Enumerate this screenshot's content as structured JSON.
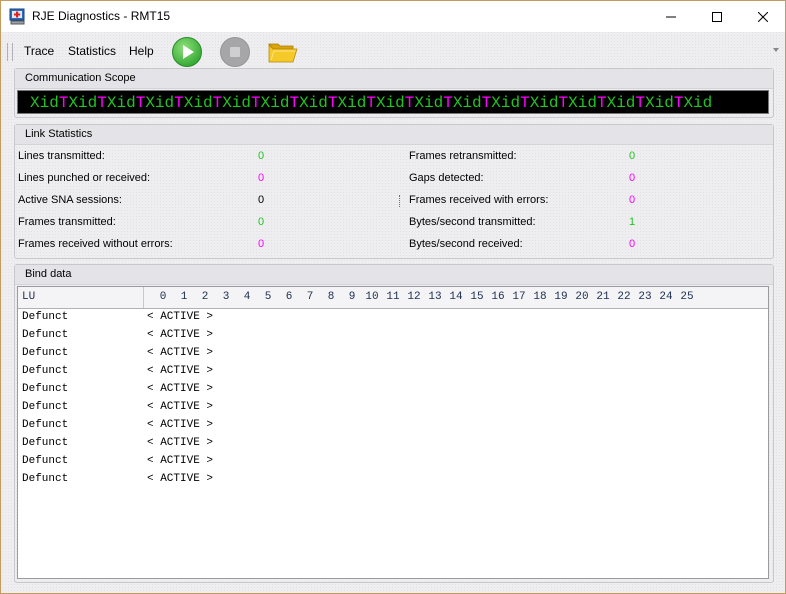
{
  "window": {
    "title": "RJE Diagnostics - RMT15",
    "controls": [
      "minimize",
      "maximize",
      "close"
    ]
  },
  "menu": {
    "items": [
      "Trace",
      "Statistics",
      "Help"
    ]
  },
  "toolbar": {
    "buttons": [
      {
        "name": "start",
        "icon": "play-icon",
        "enabled": true,
        "color": "#3cb83c"
      },
      {
        "name": "stop",
        "icon": "stop-icon",
        "enabled": false,
        "color": "#a8a8a8"
      },
      {
        "name": "open",
        "icon": "folder-icon",
        "enabled": true,
        "color": "#f2c21c"
      }
    ]
  },
  "communication_scope": {
    "title": "Communication Scope",
    "text": "XidTXidTXidTXidTXidTXidTXidTXidTXidTXidTXidTXidTXidTXidTXidTXidTXidTXid",
    "colors": {
      "data": "#22c322",
      "marker": "#ff00ff",
      "background": "#000000"
    }
  },
  "link_statistics": {
    "title": "Link Statistics",
    "left": [
      {
        "label": "Lines transmitted:",
        "value": "0",
        "color": "#22c322"
      },
      {
        "label": "Lines punched or received:",
        "value": "0",
        "color": "#ff00ff"
      },
      {
        "label": "Active SNA sessions:",
        "value": "0",
        "color": "#000000"
      },
      {
        "label": "Frames transmitted:",
        "value": "0",
        "color": "#22c322"
      },
      {
        "label": "Frames received without errors:",
        "value": "0",
        "color": "#ff00ff"
      }
    ],
    "right": [
      {
        "label": "Frames retransmitted:",
        "value": "0",
        "color": "#22c322"
      },
      {
        "label": "Gaps detected:",
        "value": "0",
        "color": "#ff00ff"
      },
      {
        "label": "Frames received with errors:",
        "value": "0",
        "color": "#ff00ff"
      },
      {
        "label": "Bytes/second transmitted:",
        "value": "1",
        "color": "#22c322"
      },
      {
        "label": "Bytes/second received:",
        "value": "0",
        "color": "#ff00ff"
      }
    ]
  },
  "bind_data": {
    "title": "Bind data",
    "header_lu": "LU",
    "columns": [
      "0",
      "1",
      "2",
      "3",
      "4",
      "5",
      "6",
      "7",
      "8",
      "9",
      "10",
      "11",
      "12",
      "13",
      "14",
      "15",
      "16",
      "17",
      "18",
      "19",
      "20",
      "21",
      "22",
      "23",
      "24",
      "25"
    ],
    "rows": [
      {
        "lu": "Defunct",
        "status": "< ACTIVE >"
      },
      {
        "lu": "Defunct",
        "status": "< ACTIVE >"
      },
      {
        "lu": "Defunct",
        "status": "< ACTIVE >"
      },
      {
        "lu": "Defunct",
        "status": "< ACTIVE >"
      },
      {
        "lu": "Defunct",
        "status": "< ACTIVE >"
      },
      {
        "lu": "Defunct",
        "status": "< ACTIVE >"
      },
      {
        "lu": "Defunct",
        "status": "< ACTIVE >"
      },
      {
        "lu": "Defunct",
        "status": "< ACTIVE >"
      },
      {
        "lu": "Defunct",
        "status": "< ACTIVE >"
      },
      {
        "lu": "Defunct",
        "status": "< ACTIVE >"
      }
    ]
  }
}
